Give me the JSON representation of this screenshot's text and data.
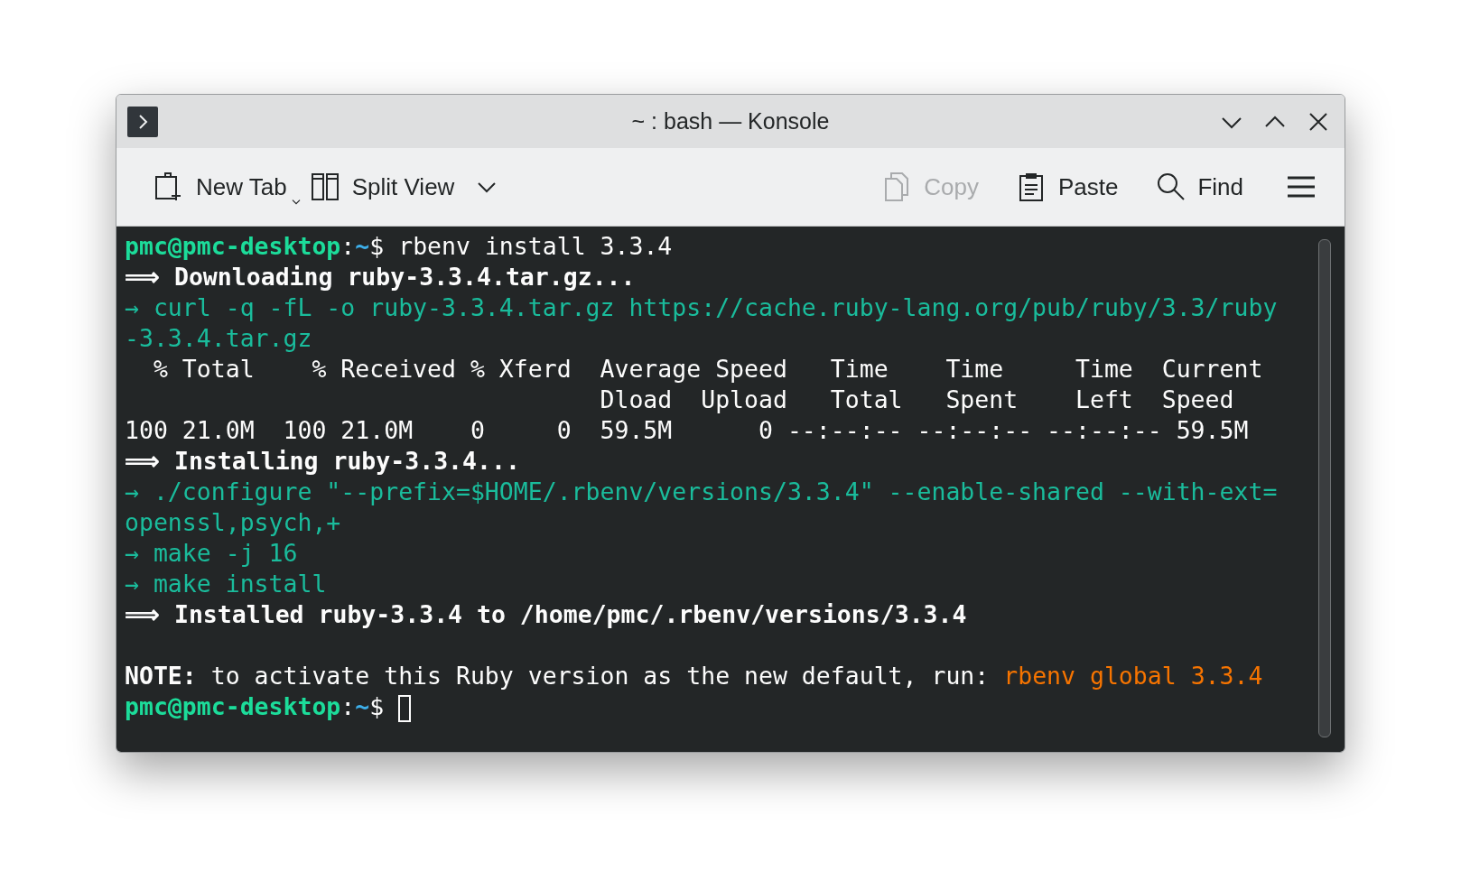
{
  "window": {
    "title": "~ : bash — Konsole"
  },
  "toolbar": {
    "left": [
      {
        "kind": "new-tab",
        "label": "New Tab",
        "disabled": false,
        "menu": true
      },
      {
        "kind": "split-view",
        "label": "Split View",
        "disabled": false,
        "menu": false
      }
    ],
    "right": [
      {
        "kind": "copy",
        "label": "Copy",
        "disabled": true
      },
      {
        "kind": "paste",
        "label": "Paste",
        "disabled": false
      },
      {
        "kind": "find",
        "label": "Find",
        "disabled": false
      }
    ]
  },
  "terminal": {
    "cursor": true,
    "lines": [
      {
        "kind": "text",
        "segments": [
          {
            "kind": "user",
            "text": "pmc@pmc-desktop"
          },
          {
            "kind": "plain",
            "text": ":"
          },
          {
            "kind": "path",
            "text": "~"
          },
          {
            "kind": "plain",
            "text": "$ rbenv install 3.3.4"
          }
        ]
      },
      {
        "kind": "text",
        "segments": [
          {
            "kind": "bold",
            "text": "⟹ Downloading ruby-3.3.4.tar.gz..."
          }
        ]
      },
      {
        "kind": "text",
        "segments": [
          {
            "kind": "info",
            "text": "→ curl -q -fL -o ruby-3.3.4.tar.gz https://cache.ruby-lang.org/pub/ruby/3.3/ruby"
          }
        ]
      },
      {
        "kind": "text",
        "segments": [
          {
            "kind": "info",
            "text": "-3.3.4.tar.gz"
          }
        ]
      },
      {
        "kind": "text",
        "segments": [
          {
            "kind": "plain",
            "text": "  % Total    % Received % Xferd  Average Speed   Time    Time     Time  Current"
          }
        ]
      },
      {
        "kind": "text",
        "segments": [
          {
            "kind": "plain",
            "text": "                                 Dload  Upload   Total   Spent    Left  Speed"
          }
        ]
      },
      {
        "kind": "text",
        "segments": [
          {
            "kind": "plain",
            "text": "100 21.0M  100 21.0M    0     0  59.5M      0 --:--:-- --:--:-- --:--:-- 59.5M"
          }
        ]
      },
      {
        "kind": "text",
        "segments": [
          {
            "kind": "bold",
            "text": "⟹ Installing ruby-3.3.4..."
          }
        ]
      },
      {
        "kind": "text",
        "segments": [
          {
            "kind": "info",
            "text": "→ ./configure \"--prefix=$HOME/.rbenv/versions/3.3.4\" --enable-shared --with-ext="
          }
        ]
      },
      {
        "kind": "text",
        "segments": [
          {
            "kind": "info",
            "text": "openssl,psych,+"
          }
        ]
      },
      {
        "kind": "text",
        "segments": [
          {
            "kind": "info",
            "text": "→ make -j 16"
          }
        ]
      },
      {
        "kind": "text",
        "segments": [
          {
            "kind": "info",
            "text": "→ make install"
          }
        ]
      },
      {
        "kind": "text",
        "segments": [
          {
            "kind": "bold",
            "text": "⟹ Installed ruby-3.3.4 to /home/pmc/.rbenv/versions/3.3.4"
          }
        ]
      },
      {
        "kind": "blank"
      },
      {
        "kind": "text",
        "segments": [
          {
            "kind": "bold",
            "text": "NOTE:"
          },
          {
            "kind": "plain",
            "text": " to activate this Ruby version as the new default, run: "
          },
          {
            "kind": "hint",
            "text": "rbenv global 3.3.4"
          }
        ]
      },
      {
        "kind": "text",
        "segments": [
          {
            "kind": "user",
            "text": "pmc@pmc-desktop"
          },
          {
            "kind": "plain",
            "text": ":"
          },
          {
            "kind": "path",
            "text": "~"
          },
          {
            "kind": "plain",
            "text": "$ "
          }
        ]
      }
    ]
  }
}
